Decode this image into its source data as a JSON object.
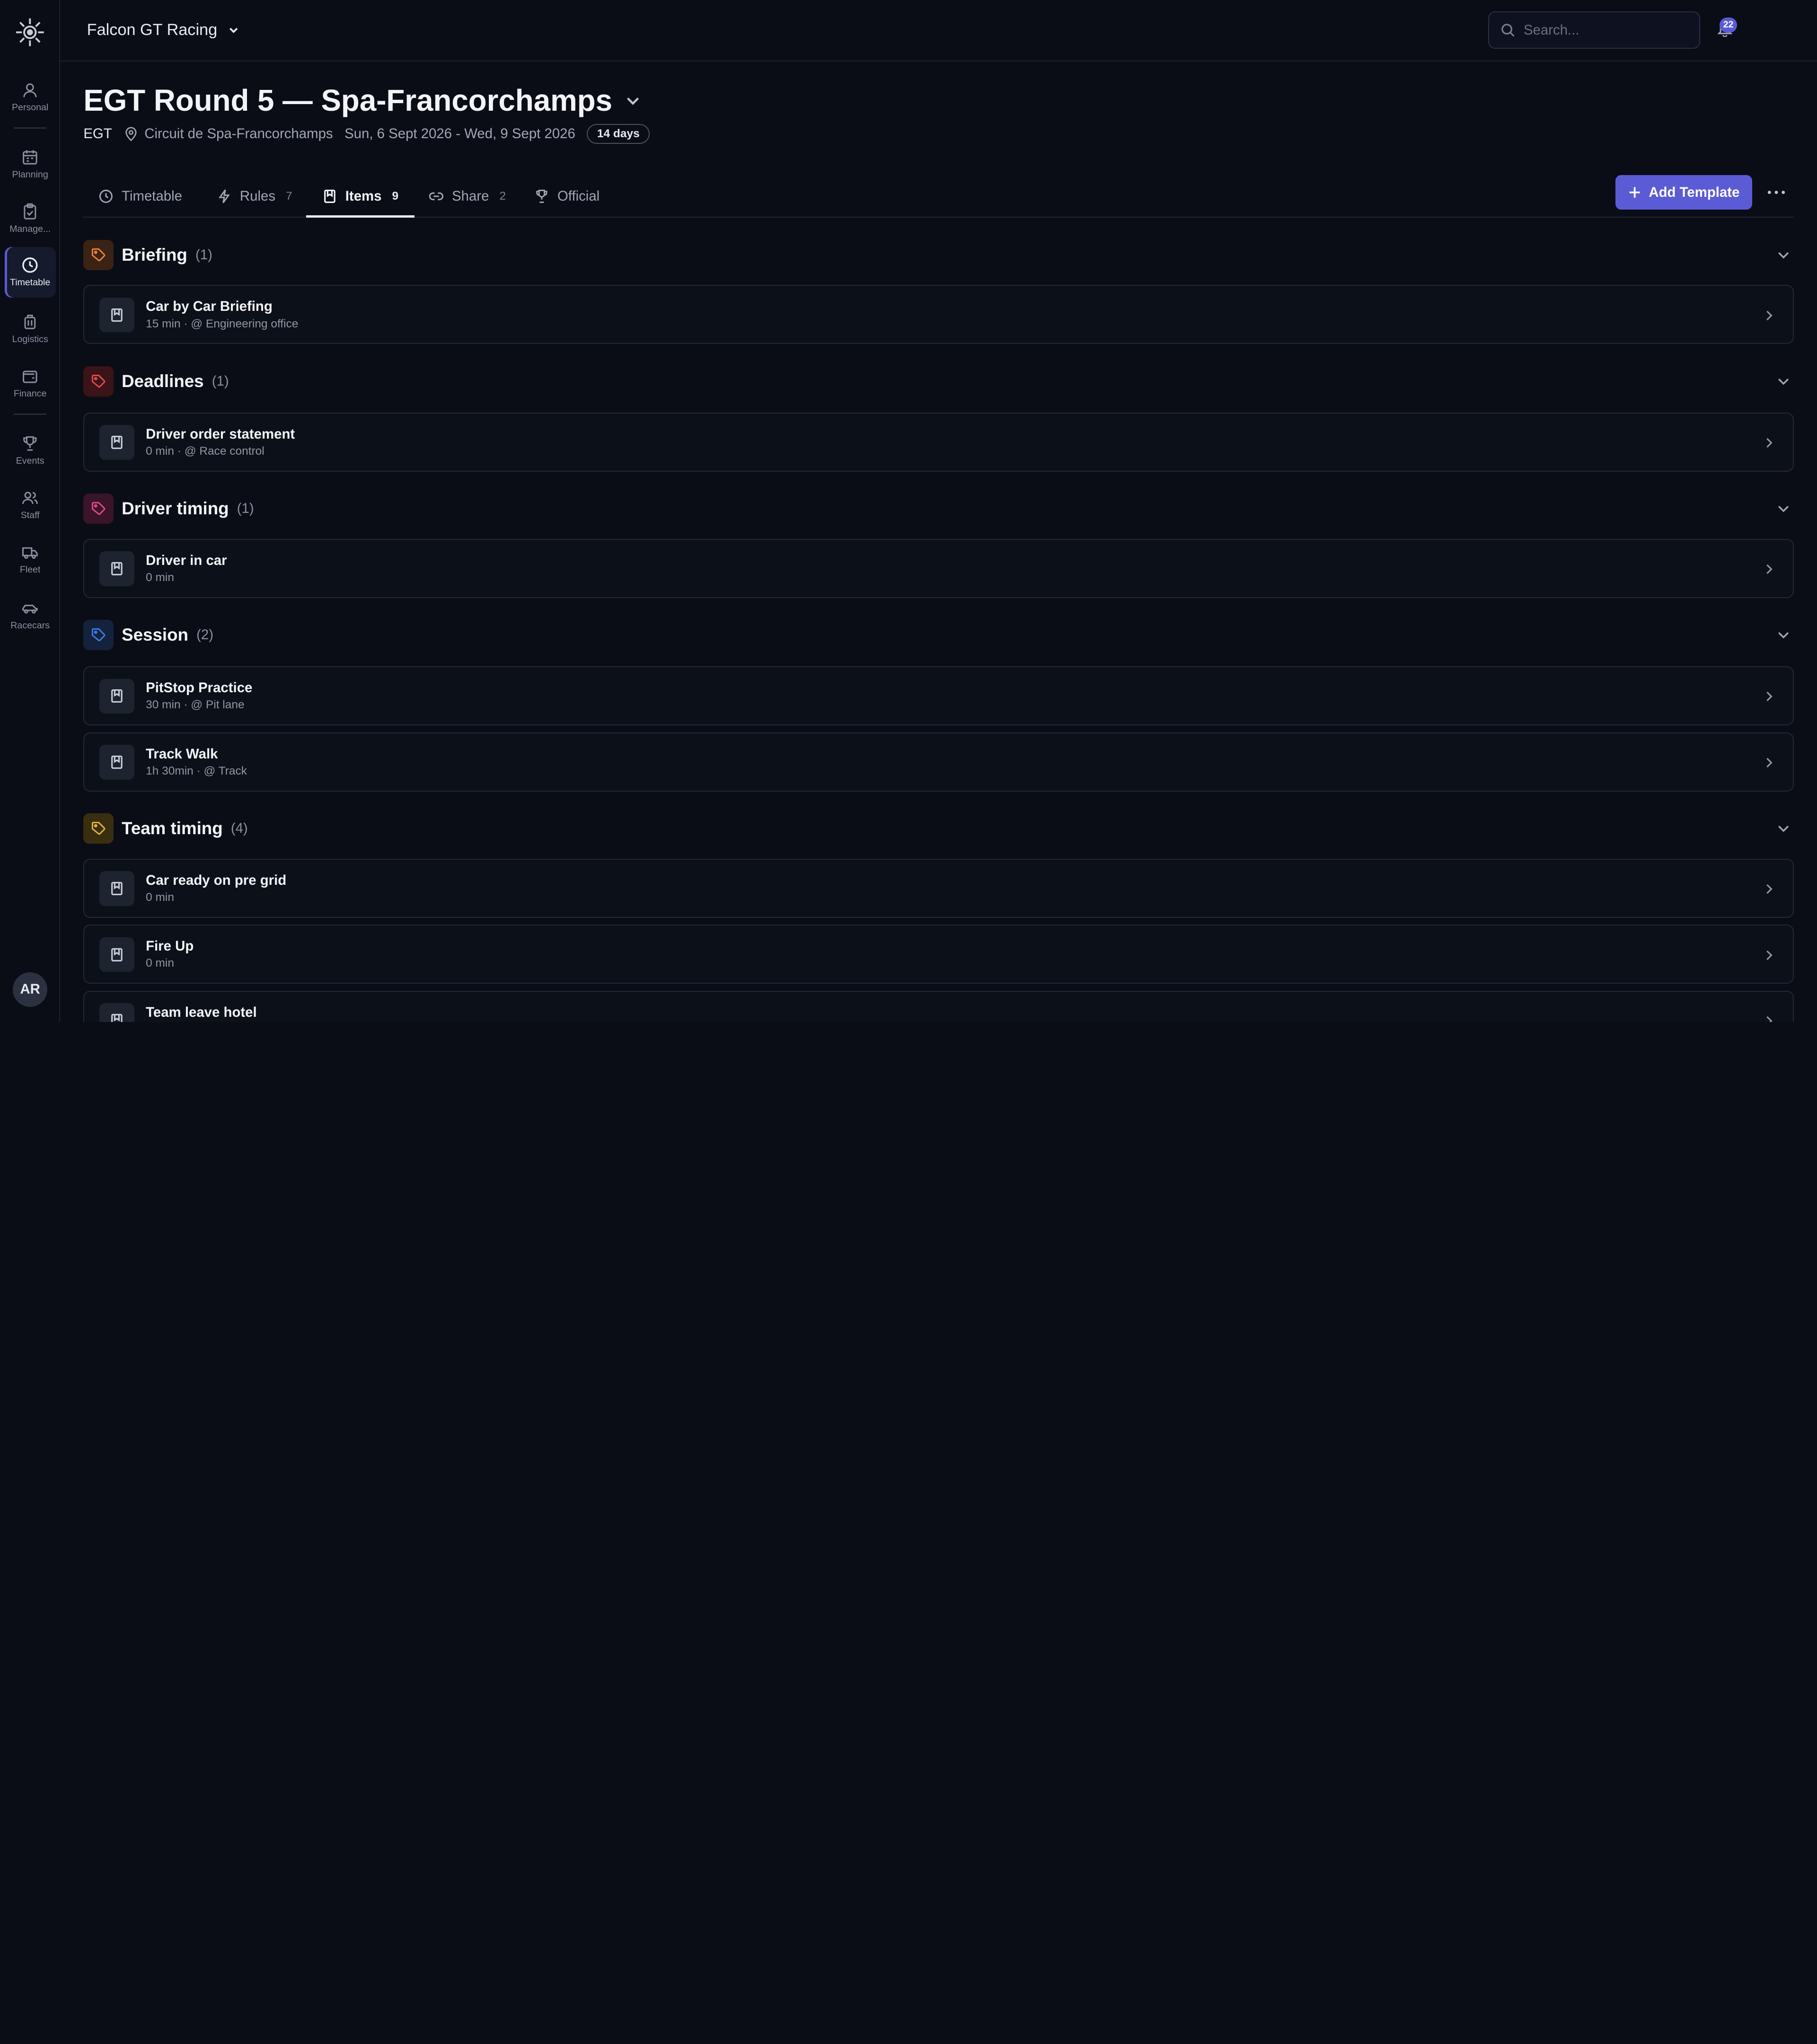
{
  "colors": {
    "background": "#0a0d16",
    "accent": "#5b5bd6",
    "briefing": "#e8823a",
    "deadlines": "#e5484d",
    "driver_timing": "#e0488a",
    "session": "#3e7be6",
    "team_timing": "#e0b040"
  },
  "topbar": {
    "org_name": "Falcon GT Racing",
    "search_placeholder": "Search...",
    "notification_count": "22"
  },
  "sidebar": {
    "items": [
      {
        "label": "Personal",
        "icon": "user-icon"
      },
      {
        "label": "Planning",
        "icon": "calendar-icon"
      },
      {
        "label": "Manage...",
        "icon": "clipboard-icon"
      },
      {
        "label": "Timetable",
        "icon": "clock-icon"
      },
      {
        "label": "Logistics",
        "icon": "luggage-icon"
      },
      {
        "label": "Finance",
        "icon": "wallet-icon"
      },
      {
        "label": "Events",
        "icon": "trophy-icon"
      },
      {
        "label": "Staff",
        "icon": "users-icon"
      },
      {
        "label": "Fleet",
        "icon": "truck-icon"
      },
      {
        "label": "Racecars",
        "icon": "car-icon"
      }
    ],
    "active": "Timetable",
    "avatar_initials": "AR"
  },
  "header": {
    "title": "EGT Round 5 — Spa-Francorchamps",
    "series": "EGT",
    "location": "Circuit de Spa-Francorchamps",
    "dates": "Sun, 6 Sept 2026 - Wed, 9 Sept 2026",
    "duration": "14 days"
  },
  "tabs": [
    {
      "label": "Timetable",
      "count": ""
    },
    {
      "label": "Rules",
      "count": "7"
    },
    {
      "label": "Items",
      "count": "9"
    },
    {
      "label": "Share",
      "count": "2"
    },
    {
      "label": "Official",
      "count": ""
    }
  ],
  "active_tab": "Items",
  "actions": {
    "add_template_label": "Add Template"
  },
  "groups": [
    {
      "name": "Briefing",
      "count": "(1)",
      "items": [
        {
          "title": "Car by Car Briefing",
          "subtitle": "15 min · @ Engineering office"
        }
      ]
    },
    {
      "name": "Deadlines",
      "count": "(1)",
      "items": [
        {
          "title": "Driver order statement",
          "subtitle": "0 min · @ Race control"
        }
      ]
    },
    {
      "name": "Driver timing",
      "count": "(1)",
      "items": [
        {
          "title": "Driver in car",
          "subtitle": "0 min"
        }
      ]
    },
    {
      "name": "Session",
      "count": "(2)",
      "items": [
        {
          "title": "PitStop Practice",
          "subtitle": "30 min · @ Pit lane"
        },
        {
          "title": "Track Walk",
          "subtitle": "1h 30min · @ Track"
        }
      ]
    },
    {
      "name": "Team timing",
      "count": "(4)",
      "items": [
        {
          "title": "Car ready on pre grid",
          "subtitle": "0 min"
        },
        {
          "title": "Fire Up",
          "subtitle": "0 min"
        },
        {
          "title": "Team leave hotel",
          "subtitle": ""
        }
      ]
    }
  ]
}
